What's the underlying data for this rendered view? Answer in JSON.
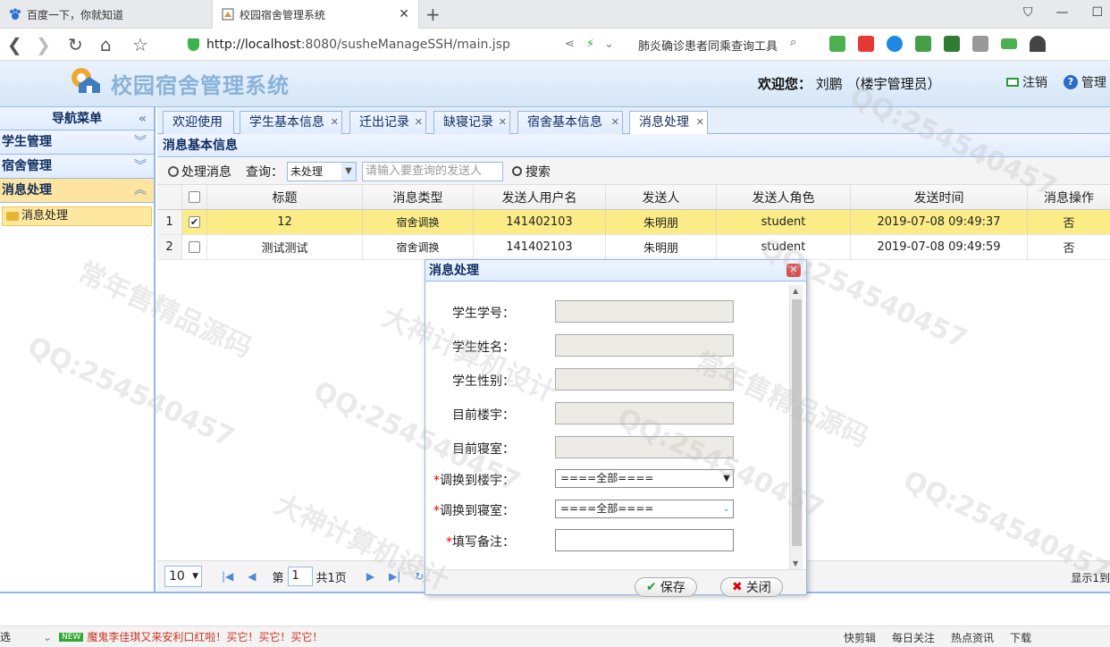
{
  "browser": {
    "tabs": [
      {
        "title": "百度一下，你就知道"
      },
      {
        "title": "校园宿舍管理系统"
      }
    ],
    "url_host": "http://localhost",
    "url_rest": ":8080/susheManageSSH/main.jsp",
    "search_text": "肺炎确诊患者同乘查询工具"
  },
  "app": {
    "title": "校园宿舍管理系统",
    "welcome_label": "欢迎您：",
    "user": "刘鹏 （楼宇管理员）",
    "logout": "注销",
    "manage": "管理"
  },
  "sidebar": {
    "title": "导航菜单",
    "groups": [
      {
        "label": "学生管理"
      },
      {
        "label": "宿舍管理"
      },
      {
        "label": "消息处理"
      }
    ],
    "sub_item": "消息处理"
  },
  "main_tabs": [
    {
      "label": "欢迎使用"
    },
    {
      "label": "学生基本信息"
    },
    {
      "label": "迁出记录"
    },
    {
      "label": "缺寝记录"
    },
    {
      "label": "宿舍基本信息"
    },
    {
      "label": "消息处理"
    }
  ],
  "panel_title": "消息基本信息",
  "toolbar": {
    "handle_btn": "处理消息",
    "query_label": "查询：",
    "status_select": "未处理",
    "search_placeholder": "请输入要查询的发送人",
    "search_btn": "搜索"
  },
  "grid": {
    "columns": [
      "标题",
      "消息类型",
      "发送人用户名",
      "发送人",
      "发送人角色",
      "发送时间",
      "消息操作"
    ],
    "rows": [
      {
        "num": "1",
        "checked": "✔",
        "title": "12",
        "type": "宿舍调换",
        "username": "141402103",
        "sender": "朱明朋",
        "role": "student",
        "time": "2019-07-08 09:49:37",
        "op": "否"
      },
      {
        "num": "2",
        "checked": "",
        "title": "测试测试",
        "type": "宿舍调换",
        "username": "141402103",
        "sender": "朱明朋",
        "role": "student",
        "time": "2019-07-08 09:49:59",
        "op": "否"
      }
    ]
  },
  "pager": {
    "page_size": "10",
    "page_prefix": "第",
    "page_num": "1",
    "page_total": "共1页",
    "info": "显示1到"
  },
  "dialog": {
    "title": "消息处理",
    "fields": [
      {
        "label": "学生学号：",
        "required": ""
      },
      {
        "label": "学生姓名：",
        "required": ""
      },
      {
        "label": "学生性别：",
        "required": ""
      },
      {
        "label": "目前楼宇：",
        "required": ""
      },
      {
        "label": "目前寝室：",
        "required": ""
      }
    ],
    "building_label": "调换到楼宇：",
    "room_label": "调换到寝室：",
    "note_label": "填写备注：",
    "required_mark": "*",
    "building_value": "====全部====",
    "room_value": "====全部====",
    "save": "保存",
    "close": "关闭"
  },
  "statusbar": {
    "left": "选",
    "news_badge": "NEW",
    "news": "魔鬼李佳琪又来安利口红啦！买它！买它！买它！",
    "items": [
      "快剪辑",
      "每日关注",
      "热点资讯",
      "下载"
    ]
  },
  "watermarks": [
    "QQ:254540457",
    "常年售精品源码",
    "大神计算机设计"
  ],
  "colors": {
    "accent": "#95b8e7",
    "selected_row": "#fbec88",
    "title_text": "#8ab2d9"
  }
}
